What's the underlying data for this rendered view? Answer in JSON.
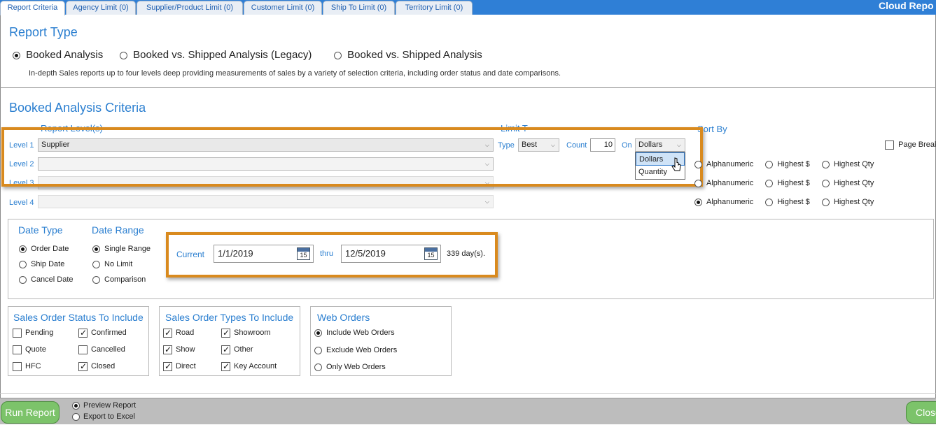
{
  "tabs": [
    {
      "label": "Report Criteria",
      "active": true
    },
    {
      "label": "Agency Limit (0)"
    },
    {
      "label": "Supplier/Product Limit (0)"
    },
    {
      "label": "Customer Limit (0)"
    },
    {
      "label": "Ship To Limit (0)"
    },
    {
      "label": "Territory Limit (0)"
    }
  ],
  "app_title": "Cloud Repo",
  "report_type": {
    "heading": "Report Type",
    "options": [
      "Booked Analysis",
      "Booked vs. Shipped Analysis (Legacy)",
      "Booked vs. Shipped Analysis"
    ],
    "selected": "Booked Analysis",
    "description": "In-depth Sales reports up to four levels deep providing measurements of sales by a variety of selection criteria, including order status and date comparisons."
  },
  "criteria": {
    "heading": "Booked Analysis Criteria",
    "report_levels_header": "Report Level(s)",
    "limit_type_header": "Limit T",
    "sort_by_header": "Sort By",
    "levels": [
      {
        "label": "Level 1",
        "value": "Supplier"
      },
      {
        "label": "Level 2",
        "value": ""
      },
      {
        "label": "Level 3",
        "value": ""
      },
      {
        "label": "Level 4",
        "value": ""
      }
    ],
    "type_label": "Type",
    "type_value": "Best",
    "count_label": "Count",
    "count_value": "10",
    "on_label": "On",
    "on_value": "Dollars",
    "on_options": [
      "Dollars",
      "Quantity"
    ],
    "page_break_label": "Page Break",
    "sort_options": [
      "Alphanumeric",
      "Highest $",
      "Highest Qty"
    ]
  },
  "date_type": {
    "heading": "Date Type",
    "options": [
      "Order Date",
      "Ship Date",
      "Cancel Date"
    ],
    "selected": "Order Date"
  },
  "date_range": {
    "heading": "Date Range",
    "options": [
      "Single Range",
      "No Limit",
      "Comparison"
    ],
    "selected": "Single Range",
    "current_label": "Current",
    "from": "1/1/2019",
    "thru_label": "thru",
    "to": "12/5/2019",
    "days_text": "339 day(s).",
    "calendar_day": "15"
  },
  "status_group": {
    "heading": "Sales Order Status To Include",
    "items": [
      {
        "label": "Pending",
        "checked": false
      },
      {
        "label": "Confirmed",
        "checked": true
      },
      {
        "label": "Quote",
        "checked": false
      },
      {
        "label": "Cancelled",
        "checked": false
      },
      {
        "label": "HFC",
        "checked": false
      },
      {
        "label": "Closed",
        "checked": true
      }
    ]
  },
  "types_group": {
    "heading": "Sales Order Types To Include",
    "items": [
      {
        "label": "Road",
        "checked": true
      },
      {
        "label": "Showroom",
        "checked": true
      },
      {
        "label": "Show",
        "checked": true
      },
      {
        "label": "Other",
        "checked": true
      },
      {
        "label": "Direct",
        "checked": true
      },
      {
        "label": "Key Account",
        "checked": true
      }
    ]
  },
  "web_orders": {
    "heading": "Web Orders",
    "options": [
      "Include Web Orders",
      "Exclude Web Orders",
      "Only Web Orders"
    ],
    "selected": "Include Web Orders"
  },
  "footer": {
    "run_label": "Run Report",
    "output_options": [
      "Preview Report",
      "Export to Excel"
    ],
    "selected_output": "Preview Report",
    "close_label": "Close"
  },
  "colors": {
    "accent_blue": "#2b7fd0",
    "highlight_orange": "#d98a1e",
    "button_green": "#7cc36a"
  }
}
